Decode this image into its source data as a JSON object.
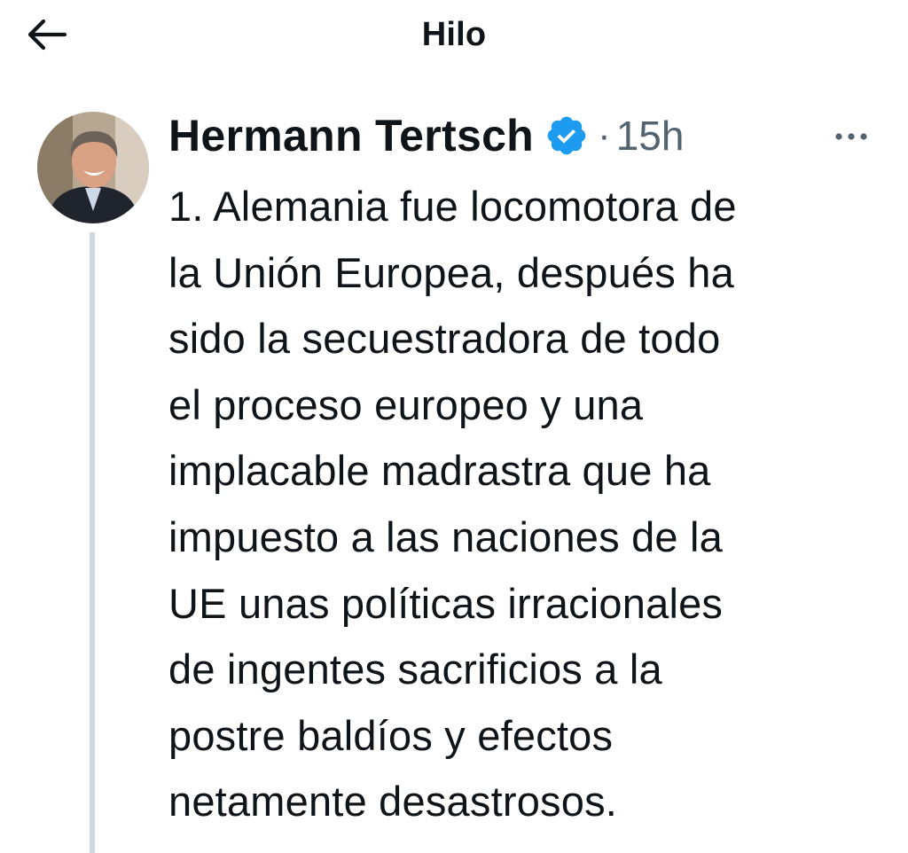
{
  "header": {
    "title": "Hilo",
    "back_icon": "arrow-left-icon"
  },
  "tweet": {
    "author": {
      "display_name": "Hermann Tertsch",
      "verified": true,
      "verified_icon": "verified-badge-icon",
      "avatar_icon": "avatar-photo"
    },
    "separator": "·",
    "time": "15h",
    "more_icon": "more-options-icon",
    "text": "1. Alemania fue locomotora de\nla Unión Europea, después ha\nsido la secuestradora de todo\nel proceso europeo y una\nimplacable madrastra que ha\nimpuesto a las naciones de la\nUE unas políticas irracionales\nde ingentes sacrificios a la\npostre baldíos y efectos\nnetamente desastrosos."
  },
  "colors": {
    "text_primary": "#0f1419",
    "text_secondary": "#536471",
    "verified_badge": "#1d9bf0",
    "thread_line": "#cfd9de",
    "background": "#ffffff"
  }
}
